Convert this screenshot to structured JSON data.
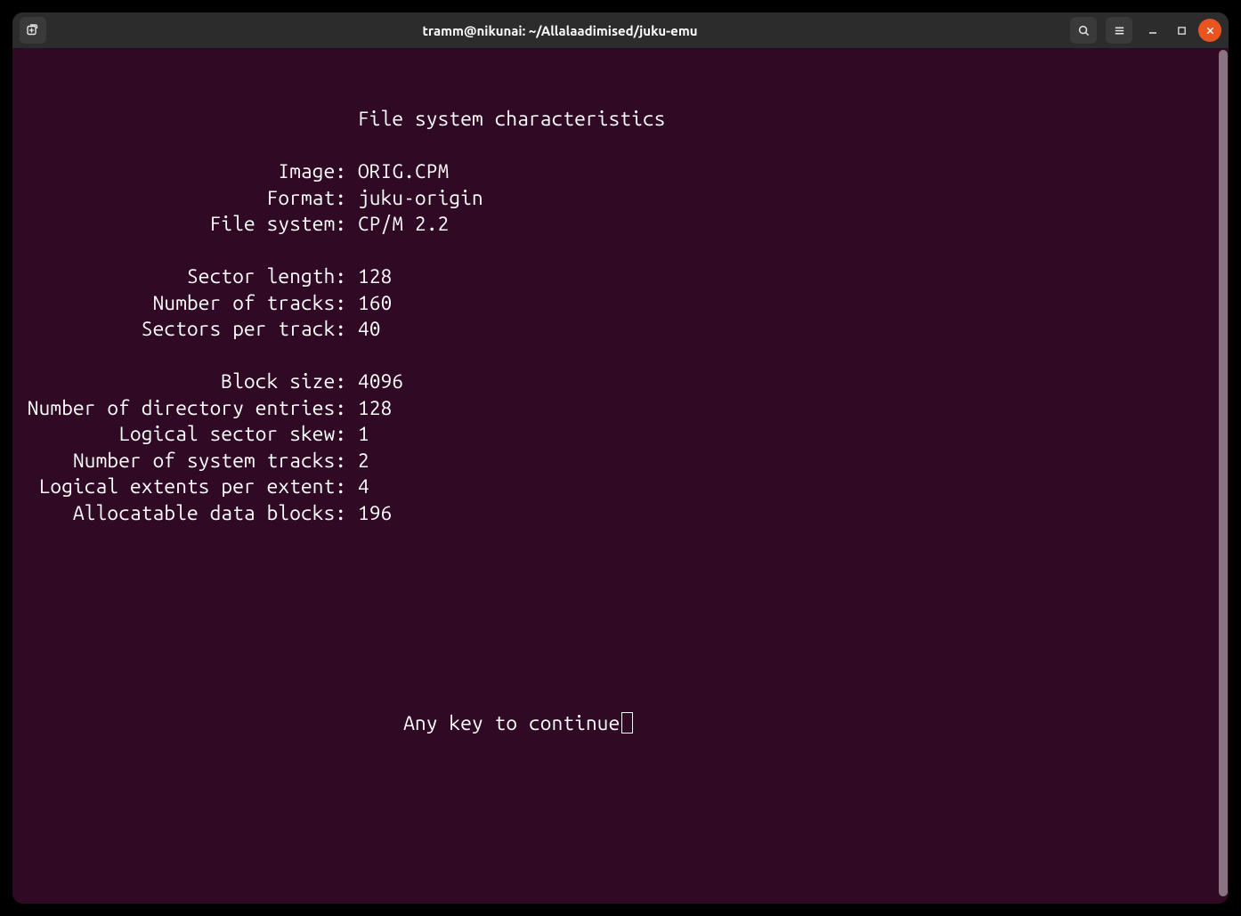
{
  "window": {
    "title": "tramm@nikunai: ~/Allalaadimised/juku-emu"
  },
  "titlebar": {
    "newtab_icon": "new-tab-icon",
    "search_icon": "search-icon",
    "menu_icon": "hamburger-menu-icon",
    "minimize_icon": "minimize-icon",
    "maximize_icon": "maximize-icon",
    "close_icon": "close-icon"
  },
  "terminal": {
    "title_line": "                              File system characteristics",
    "rows": [
      {
        "label": "Image",
        "value": "ORIG.CPM"
      },
      {
        "label": "Format",
        "value": "juku-origin"
      },
      {
        "label": "File system",
        "value": "CP/M 2.2"
      }
    ],
    "geometry": [
      {
        "label": "Sector length",
        "value": "128"
      },
      {
        "label": "Number of tracks",
        "value": "160"
      },
      {
        "label": "Sectors per track",
        "value": "40"
      }
    ],
    "blocks": [
      {
        "label": "Block size",
        "value": "4096"
      },
      {
        "label": "Number of directory entries",
        "value": "128"
      },
      {
        "label": "Logical sector skew",
        "value": "1"
      },
      {
        "label": "Number of system tracks",
        "value": "2"
      },
      {
        "label": "Logical extents per extent",
        "value": "4"
      },
      {
        "label": "Allocatable data blocks",
        "value": "196"
      }
    ],
    "continue_prompt": "                                  Any key to continue"
  }
}
